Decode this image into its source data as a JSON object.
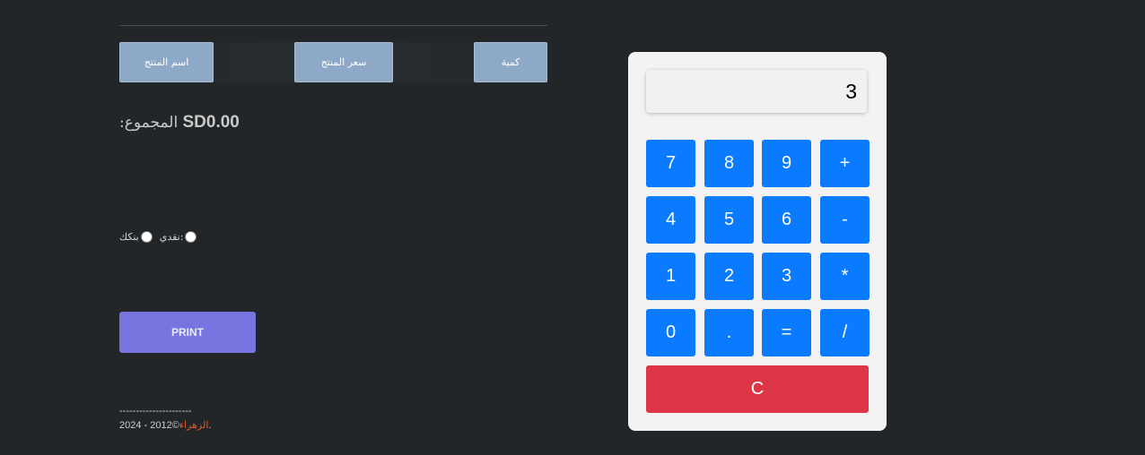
{
  "pos": {
    "columns": {
      "product_name": "اسم المنتج",
      "product_price": "سعر المنتج",
      "quantity": "كمية"
    },
    "total": {
      "label": ":المجموع",
      "amount": "SD0.00"
    },
    "payment": {
      "cash_label": "نقدي:",
      "bank_label": "بنكك"
    },
    "print_label": "PRINT",
    "footer": {
      "separator": "----------------------",
      "years": "2024 - 2012©",
      "brand": "الزهراء",
      "period": "."
    }
  },
  "calculator": {
    "display_value": "3",
    "keys": [
      "7",
      "8",
      "9",
      "+",
      "4",
      "5",
      "6",
      "-",
      "1",
      "2",
      "3",
      "*",
      "0",
      ".",
      "=",
      "/"
    ],
    "clear_label": "C",
    "colors": {
      "key": "#0a7bff",
      "clear": "#dc3545"
    }
  }
}
